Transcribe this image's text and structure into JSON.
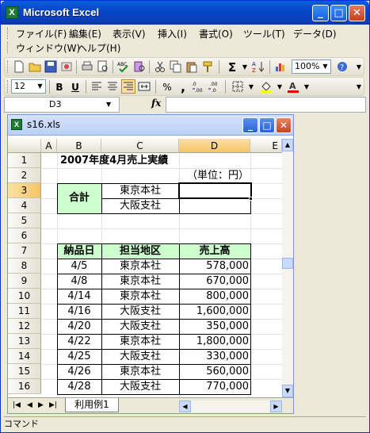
{
  "app": {
    "title": "Microsoft Excel",
    "icon": "X"
  },
  "menu": {
    "row1": [
      "ファイル(F)",
      "編集(E)",
      "表示(V)",
      "挿入(I)",
      "書式(O)",
      "ツール(T)",
      "データ(D)"
    ],
    "row2": [
      "ウィンドウ(W)",
      "ヘルプ(H)"
    ]
  },
  "toolbar": {
    "zoom": "100%",
    "font_size": "12",
    "bold": "B",
    "underline": "U",
    "percent": "%",
    "comma": ","
  },
  "formula_bar": {
    "name_box": "D3",
    "fx": "fx",
    "value": ""
  },
  "workbook": {
    "title": "s16.xls",
    "icon": "X",
    "columns": [
      "A",
      "B",
      "C",
      "D",
      "E"
    ],
    "active_column": "D",
    "active_row": "3",
    "rows": [
      "1",
      "2",
      "3",
      "4",
      "5",
      "6",
      "7",
      "8",
      "9",
      "10",
      "11",
      "12",
      "13",
      "14",
      "15",
      "16"
    ],
    "title_cell": "2007年度4月売上実績",
    "unit": "（単位：円）",
    "summary": {
      "label": "合計",
      "regions": [
        "東京本社",
        "大阪支社"
      ]
    },
    "headers": [
      "納品日",
      "担当地区",
      "売上高"
    ],
    "data": [
      {
        "date": "4/5",
        "region": "東京本社",
        "sales": "578,000"
      },
      {
        "date": "4/8",
        "region": "東京本社",
        "sales": "670,000"
      },
      {
        "date": "4/14",
        "region": "東京本社",
        "sales": "800,000"
      },
      {
        "date": "4/16",
        "region": "大阪支社",
        "sales": "1,600,000"
      },
      {
        "date": "4/20",
        "region": "大阪支社",
        "sales": "350,000"
      },
      {
        "date": "4/22",
        "region": "東京本社",
        "sales": "1,800,000"
      },
      {
        "date": "4/25",
        "region": "大阪支社",
        "sales": "330,000"
      },
      {
        "date": "4/26",
        "region": "東京本社",
        "sales": "560,000"
      },
      {
        "date": "4/28",
        "region": "大阪支社",
        "sales": "770,000"
      }
    ],
    "sheet_tab": "利用例1"
  },
  "status": {
    "text": "コマンド"
  },
  "colors": {
    "header_fill": "#ccffcc",
    "active_header": "#f5c464"
  }
}
